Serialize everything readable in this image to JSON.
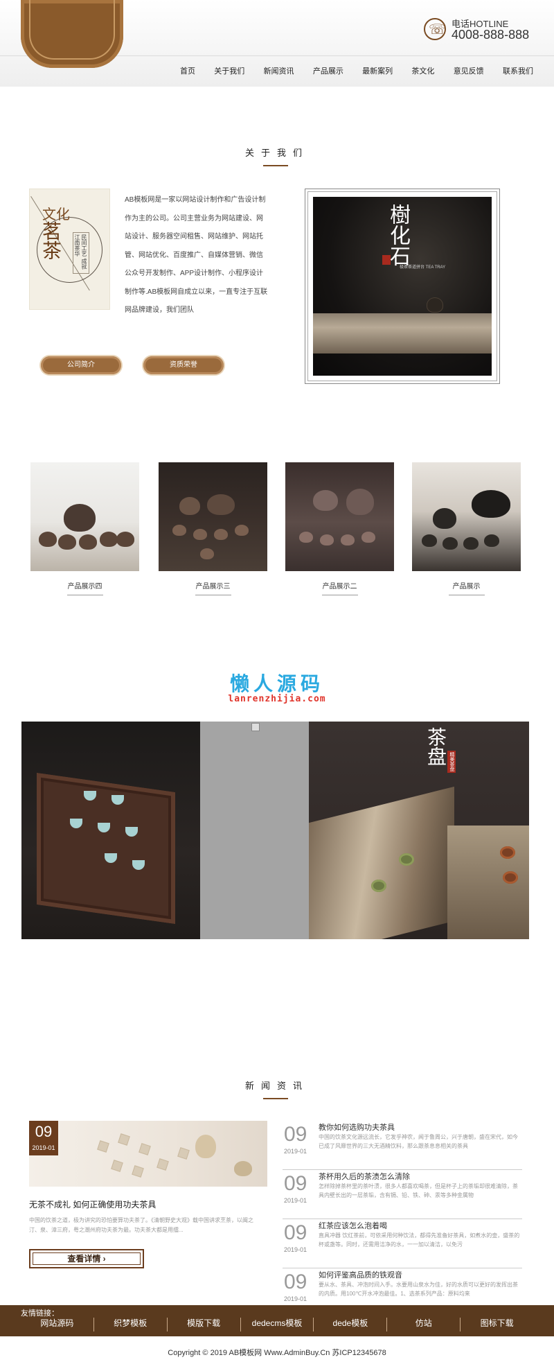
{
  "header": {
    "hotline_label": "电话HOTLINE",
    "hotline_number": "4008-888-888",
    "nav": [
      "首页",
      "关于我们",
      "新闻资讯",
      "产品展示",
      "最新案列",
      "茶文化",
      "意见反馈",
      "联系我们"
    ]
  },
  "about": {
    "title": "关于我们",
    "tea_image": {
      "char1": "文化",
      "char2": "茗茶",
      "char3": "民间工艺 成就江南茶华"
    },
    "text": "AB模板网是一家以网站设计制作和广告设计制作为主的公司。公司主营业务为网站建设、网站设计、服务器空间租售、网站维护、网站托管、网站优化、百度推广、自媒体营销、微信公众号开发制作、APP设计制作、小程序设计制作等.AB模板网自成立以来，一直专注于互联网品牌建设，我们团队",
    "buttons": [
      "公司简介",
      "资质荣誉"
    ],
    "photo": {
      "title": "樹化石",
      "sub": "极茶茶道拼台 TEA TRAY"
    }
  },
  "products": [
    {
      "label": "产品展示四"
    },
    {
      "label": "产品展示三"
    },
    {
      "label": "产品展示二"
    },
    {
      "label": "产品展示"
    }
  ],
  "watermark": {
    "title": "懒人源码",
    "sub": "lanrenzhijia.com"
  },
  "banner": {
    "title": "茶盘",
    "seal": "精美茶盘"
  },
  "news": {
    "title": "新闻资讯",
    "feature": {
      "day": "09",
      "month": "2019-01",
      "title": "无茶不成礼 如何正确使用功夫茶具",
      "desc": "中国的饮茶之道，极为讲究的恐怕要算功夫茶了。《清朝野史大观》载中国讲求烹茶，以闽之汀、泉、漳三府，粤之潮州府功夫茶为最。功夫茶大都是用擂...",
      "more": "查看详情"
    },
    "items": [
      {
        "day": "09",
        "month": "2019-01",
        "title": "教你如何选购功夫茶具",
        "desc": "中国的饮茶文化源远流长，它发乎神农，闻于鲁周公，兴于唐朝，盛在宋代，如今已成了风靡世界的三大无酒精饮料，那么跟茶息息相关的茶具"
      },
      {
        "day": "09",
        "month": "2019-01",
        "title": "茶杯用久后的茶渍怎么清除",
        "desc": "怎样除掉茶杯里的茶叶渍，很多人都喜欢喝茶，但是杯子上的茶垢却很难清除，茶具内壁长出的一层茶垢，含有镉、铅、铁、砷、汞等多种金属物"
      },
      {
        "day": "09",
        "month": "2019-01",
        "title": "红茶应该怎么泡着喝",
        "desc": "直具冲器 饮红茶前，可依采用何种饮法，都得先准备好茶具，如煮水的壶，盛茶的杯或盏等。同时，还需用洁净的水，一一加以清洁，以免污"
      },
      {
        "day": "09",
        "month": "2019-01",
        "title": "如何评鉴高品质的铁观音",
        "desc": "要从水、茶具、冲泡时间入手。水要用山泉水为佳，好的水质可以更好的发挥出茶的内质。用100℃开水冲泡最佳。1、选茶系列产品：原料均来"
      }
    ]
  },
  "footer": {
    "friend_label": "友情链接：",
    "links": [
      "网站源码",
      "织梦模板",
      "模版下载",
      "dedecms模板",
      "dede模板",
      "仿站",
      "图标下载"
    ],
    "copyright": "Copyright © 2019 AB模板网 Www.AdminBuy.Cn   苏ICP12345678"
  }
}
